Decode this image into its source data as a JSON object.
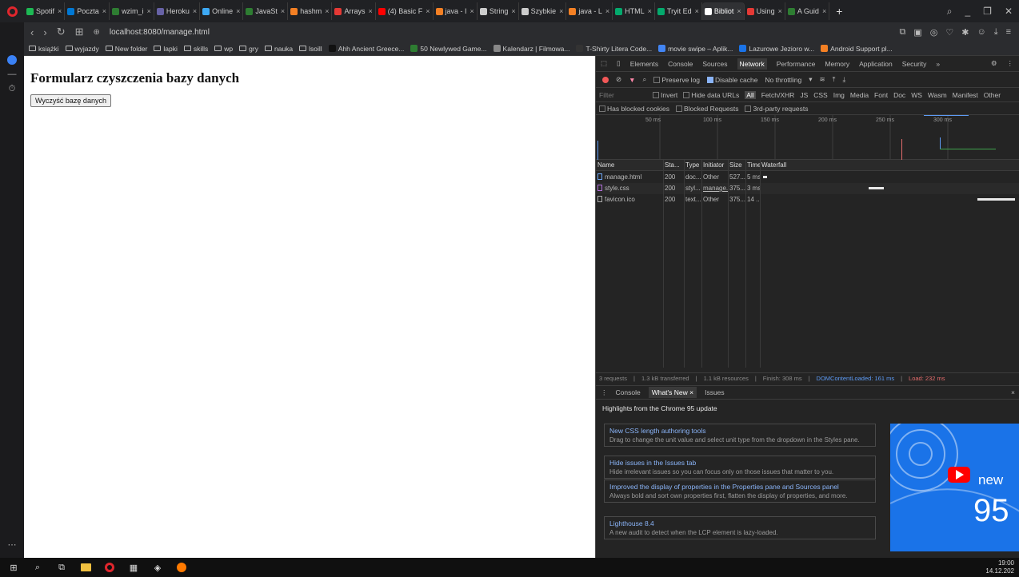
{
  "tabs": [
    {
      "label": "Spotif",
      "color": "#1db954"
    },
    {
      "label": "Poczta",
      "color": "#0078d4"
    },
    {
      "label": "wzim_i",
      "color": "#2e7d32"
    },
    {
      "label": "Heroku",
      "color": "#6762a6"
    },
    {
      "label": "Online",
      "color": "#3da9f4"
    },
    {
      "label": "JavaSt",
      "color": "#2e7d32"
    },
    {
      "label": "hashm",
      "color": "#f48024"
    },
    {
      "label": "Arrays",
      "color": "#e53935"
    },
    {
      "label": "(4) Basic F",
      "color": "#ff0000"
    },
    {
      "label": "java - I",
      "color": "#f48024"
    },
    {
      "label": "String",
      "color": "#cccccc"
    },
    {
      "label": "Szybkie",
      "color": "#cccccc"
    },
    {
      "label": "java - L",
      "color": "#f48024"
    },
    {
      "label": "HTML",
      "color": "#04aa6d"
    },
    {
      "label": "Tryit Ed",
      "color": "#04aa6d"
    },
    {
      "label": "Bibliot",
      "color": "#ffffff"
    },
    {
      "label": "Using",
      "color": "#e53935"
    },
    {
      "label": "A Guid",
      "color": "#2e7d32"
    }
  ],
  "active_tab_index": 15,
  "url": "localhost:8080/manage.html",
  "bookmarks": [
    {
      "label": "książki",
      "type": "folder"
    },
    {
      "label": "wyjazdy",
      "type": "folder"
    },
    {
      "label": "New folder",
      "type": "folder"
    },
    {
      "label": "lapki",
      "type": "folder"
    },
    {
      "label": "skills",
      "type": "folder"
    },
    {
      "label": "wp",
      "type": "folder"
    },
    {
      "label": "gry",
      "type": "folder"
    },
    {
      "label": "nauka",
      "type": "folder"
    },
    {
      "label": "lsoill",
      "type": "folder"
    },
    {
      "label": "Ahh Ancient Greece...",
      "type": "site",
      "color": "#111111"
    },
    {
      "label": "50 Newlywed Game...",
      "type": "site",
      "color": "#2e7d32"
    },
    {
      "label": "Kalendarz | Filmowa...",
      "type": "site",
      "color": "#888888"
    },
    {
      "label": "T-Shirty Litera Code...",
      "type": "site",
      "color": "#333333"
    },
    {
      "label": "movie swipe – Aplik...",
      "type": "site",
      "color": "#4285f4"
    },
    {
      "label": "Lazurowe Jezioro w...",
      "type": "site",
      "color": "#1a73e8"
    },
    {
      "label": "Android Support pl...",
      "type": "site",
      "color": "#f48024"
    }
  ],
  "page": {
    "title": "Formularz czyszczenia bazy danych",
    "button_label": "Wyczyść bazę danych"
  },
  "devtools": {
    "tabs": [
      "Elements",
      "Console",
      "Sources",
      "Network",
      "Performance",
      "Memory",
      "Application",
      "Security",
      "»"
    ],
    "active_tab": "Network",
    "toolbar": {
      "preserve_log": "Preserve log",
      "disable_cache": "Disable cache",
      "throttling": "No throttling"
    },
    "filter_placeholder": "Filter",
    "filter_options": [
      "Invert",
      "Hide data URLs"
    ],
    "filter_types": [
      "All",
      "Fetch/XHR",
      "JS",
      "CSS",
      "Img",
      "Media",
      "Font",
      "Doc",
      "WS",
      "Wasm",
      "Manifest",
      "Other"
    ],
    "active_filter": "All",
    "filter_row2": [
      "Has blocked cookies",
      "Blocked Requests",
      "3rd-party requests"
    ],
    "overview_ticks": [
      "50 ms",
      "100 ms",
      "150 ms",
      "200 ms",
      "250 ms",
      "300 ms"
    ],
    "columns": [
      "Name",
      "Sta...",
      "Type",
      "Initiator",
      "Size",
      "Time",
      "Waterfall"
    ],
    "requests": [
      {
        "name": "manage.html",
        "status": "200",
        "type": "doc...",
        "initiator": "Other",
        "size": "527...",
        "time": "5 ms",
        "start": 0.0,
        "dur": 0.017,
        "icon_color": "#6ea6f5"
      },
      {
        "name": "style.css",
        "status": "200",
        "type": "styl...",
        "initiator": "manage...",
        "size": "375...",
        "time": "3 ms",
        "start": 0.42,
        "dur": 0.06,
        "icon_color": "#b06fd8"
      },
      {
        "name": "favicon.ico",
        "status": "200",
        "type": "text...",
        "initiator": "Other",
        "size": "375...",
        "time": "14 ...",
        "start": 0.85,
        "dur": 0.15,
        "icon_color": "#aaaaaa"
      }
    ],
    "status_bar": {
      "requests": "3 requests",
      "transferred": "1.3 kB transferred",
      "resources": "1.1 kB resources",
      "finish": "Finish: 308 ms",
      "dcl": "DOMContentLoaded: 161 ms",
      "load": "Load: 232 ms"
    },
    "drawer_tabs": [
      "Console",
      "What's New ×",
      "Issues"
    ],
    "active_drawer_tab": "What's New ×",
    "whats_new_heading": "Highlights from the Chrome 95 update",
    "cards": [
      {
        "title": "New CSS length authoring tools",
        "desc": "Drag to change the unit value and select unit type from the dropdown in the Styles pane."
      },
      {
        "title": "Hide issues in the Issues tab",
        "desc": "Hide irrelevant issues so you can focus only on those issues that matter to you."
      },
      {
        "title": "Improved the display of properties in the Properties pane and Sources panel",
        "desc": "Always bold and sort own properties first, flatten the display of properties, and more."
      },
      {
        "title": "Lighthouse 8.4",
        "desc": "A new audit to detect when the LCP element is lazy-loaded."
      }
    ],
    "promo": {
      "new": "new",
      "version": "95"
    }
  },
  "taskbar": {
    "time": "19:00",
    "date": "14.12.202"
  }
}
